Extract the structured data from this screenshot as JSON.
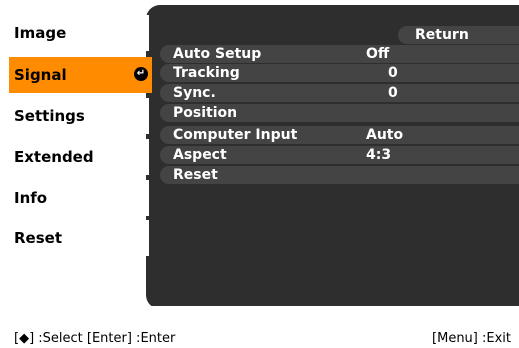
{
  "sidebar": {
    "items": [
      {
        "label": "Image"
      },
      {
        "label": "Signal",
        "active": true,
        "icon": "enter-icon"
      },
      {
        "label": "Settings"
      },
      {
        "label": "Extended"
      },
      {
        "label": "Info"
      },
      {
        "label": "Reset"
      }
    ]
  },
  "main": {
    "return_label": "Return",
    "rows": [
      {
        "label": "Auto Setup",
        "value": "Off"
      },
      {
        "label": "Tracking",
        "value": "0"
      },
      {
        "label": "Sync.",
        "value": "0"
      },
      {
        "label": "Position",
        "value": ""
      },
      {
        "label": "Computer Input",
        "value": "Auto"
      },
      {
        "label": "Aspect",
        "value": "4:3"
      },
      {
        "label": "Reset",
        "value": ""
      }
    ]
  },
  "footer": {
    "left_text": "[◆] :Select  [Enter] :Enter",
    "right_text": "[Menu] :Exit"
  },
  "colors": {
    "active_tab": "#ff8c00",
    "panel_bg": "#2e2e2e",
    "row_bg": "#444444"
  }
}
